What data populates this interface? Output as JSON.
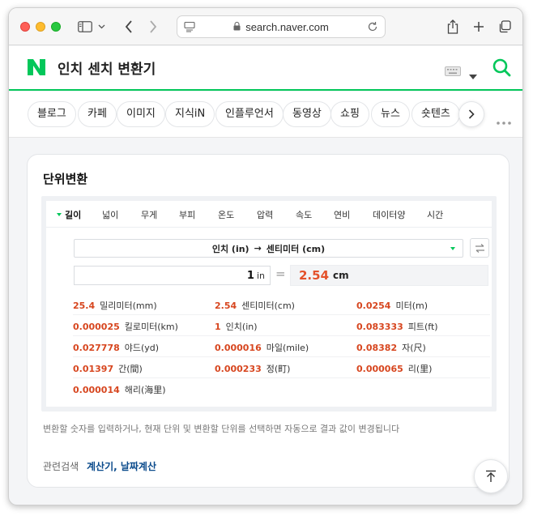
{
  "browser": {
    "url": "search.naver.com"
  },
  "header": {
    "query": "인치 센치 변환기"
  },
  "tabs": [
    "블로그",
    "카페",
    "이미지",
    "지식iN",
    "인플루언서",
    "동영상",
    "쇼핑",
    "뉴스",
    "숏텐츠"
  ],
  "card": {
    "title": "단위변환",
    "unit_tabs": [
      "길이",
      "넓이",
      "무게",
      "부피",
      "온도",
      "압력",
      "속도",
      "연비",
      "데이터양",
      "시간"
    ],
    "selected_tab": "길이",
    "from_unit": "인치 (in)",
    "arrow": "→",
    "to_unit": "센티미터 (cm)",
    "input_value": "1",
    "input_unit": "in",
    "equals": "=",
    "result_value": "2.54",
    "result_unit": "cm",
    "results": [
      {
        "value": "25.4",
        "name": "밀리미터(mm)"
      },
      {
        "value": "2.54",
        "name": "센티미터(cm)"
      },
      {
        "value": "0.0254",
        "name": "미터(m)"
      },
      {
        "value": "0.000025",
        "name": "킬로미터(km)"
      },
      {
        "value": "1",
        "name": "인치(in)"
      },
      {
        "value": "0.083333",
        "name": "피트(ft)"
      },
      {
        "value": "0.027778",
        "name": "야드(yd)"
      },
      {
        "value": "0.000016",
        "name": "마일(mile)"
      },
      {
        "value": "0.08382",
        "name": "자(尺)"
      },
      {
        "value": "0.01397",
        "name": "간(間)"
      },
      {
        "value": "0.000233",
        "name": "정(町)"
      },
      {
        "value": "0.000065",
        "name": "리(里)"
      },
      {
        "value": "0.000014",
        "name": "해리(海里)"
      }
    ],
    "description": "변환할 숫자를 입력하거나, 현재 단위 및 변환할 단위를 선택하면 자동으로 결과 값이 변경됩니다",
    "related_label": "관련검색",
    "related_links": "계산기, 날짜계산"
  },
  "colors": {
    "naver_green": "#03c75a",
    "result_orange": "#e4512a",
    "link_blue": "#0b4b8c"
  }
}
